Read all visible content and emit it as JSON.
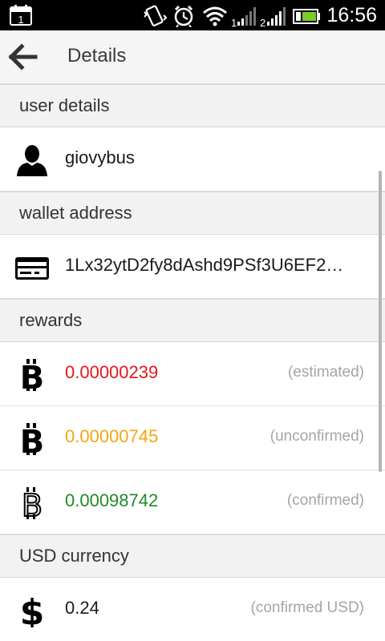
{
  "status_bar": {
    "calendar_day": "1",
    "sim1_label": "1",
    "sim2_label": "2",
    "time": "16:56",
    "icons": [
      "calendar-icon",
      "vibrate-icon",
      "alarm-icon",
      "wifi-icon",
      "signal-sim1-icon",
      "signal-sim2-icon",
      "battery-icon"
    ]
  },
  "app_bar": {
    "title": "Details",
    "back_icon": "arrow-left-icon"
  },
  "sections": {
    "user_details": {
      "header": "user details",
      "username": "giovybus",
      "icon": "person-icon"
    },
    "wallet_address": {
      "header": "wallet address",
      "address": "1Lx32ytD2fy8dAshd9PSf3U6EF2…",
      "icon": "credit-card-icon"
    },
    "rewards": {
      "header": "rewards",
      "items": [
        {
          "value": "0.00000239",
          "note": "(estimated)",
          "color": "#e8141c",
          "icon": "bitcoin-icon"
        },
        {
          "value": "0.00000745",
          "note": "(unconfirmed)",
          "color": "#f4a60c",
          "icon": "bitcoin-icon"
        },
        {
          "value": "0.00098742",
          "note": "(confirmed)",
          "color": "#218a26",
          "icon": "bitcoin-outline-icon"
        }
      ]
    },
    "usd_currency": {
      "header": "USD currency",
      "value": "0.24",
      "note": "(confirmed USD)",
      "icon": "dollar-icon"
    }
  }
}
